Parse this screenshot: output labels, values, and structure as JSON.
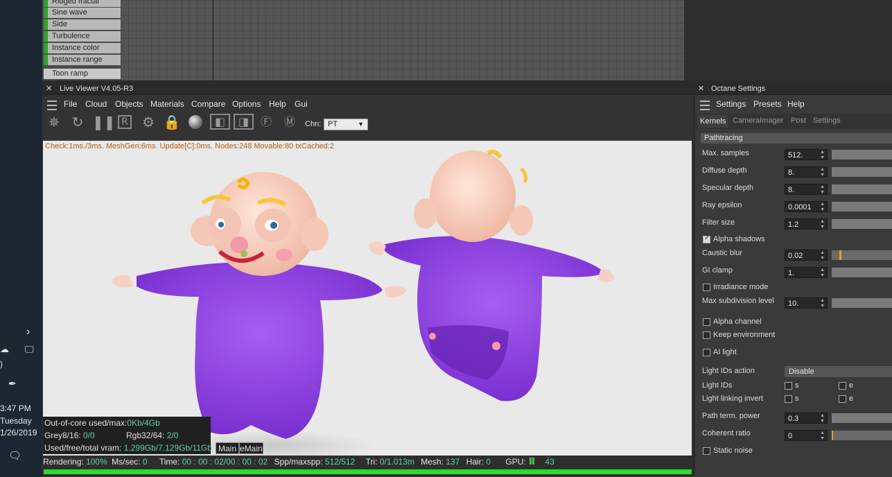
{
  "taskbar": {
    "time": "3:47 PM",
    "day": "Tuesday",
    "date": "1/26/2019"
  },
  "shader_list": {
    "items": [
      "Ridged fractal",
      "Sine wave",
      "Side",
      "Turbulence",
      "Instance color",
      "Instance range"
    ],
    "footer": "Toon ramp"
  },
  "live_viewer": {
    "title": "Live Viewer V4.05-R3",
    "menu": [
      "File",
      "Cloud",
      "Objects",
      "Materials",
      "Compare",
      "Options",
      "Help",
      "Gui"
    ],
    "channel_label": "Chn:",
    "channel_value": "PT",
    "info": "Check:1ms./3ms. MeshGen:6ms. Update[C]:0ms. Nodes:248 Movable:80 txCached:2",
    "ooc_label": "Out-of-core used/max:",
    "ooc_value": "0Kb/4Gb",
    "grey_label": "Grey8/16:",
    "grey_value": "0/0",
    "rgb_label": "Rgb32/64:",
    "rgb_value": "2/0",
    "vram_label": "Used/free/total vram:",
    "vram_value": "1.299Gb/7.129Gb/11Gb",
    "tab1": "Main",
    "tab2": "eMain",
    "status": {
      "rendering_label": "Rendering:",
      "rendering_value": "100%",
      "mssec_label": "Ms/sec:",
      "mssec_value": "0",
      "time_label": "Time:",
      "time_value": "00 : 00 : 02/00 : 00 : 02",
      "spp_label": "Spp/maxspp:",
      "spp_value": "512/512",
      "tri_label": "Tri:",
      "tri_value": "0/1.013m",
      "mesh_label": "Mesh:",
      "mesh_value": "137",
      "hair_label": "Hair:",
      "hair_value": "0",
      "gpu_label": "GPU:",
      "gpu_value": "43"
    },
    "progress": 1.0
  },
  "octane_settings": {
    "title": "Octane Settings",
    "menu": [
      "Settings",
      "Presets",
      "Help"
    ],
    "tabs": [
      "Kernels",
      "CameraImager",
      "Post",
      "Settings"
    ],
    "kernel": "Pathtracing",
    "params": {
      "max_samples": {
        "label": "Max. samples",
        "value": "512."
      },
      "diffuse_depth": {
        "label": "Diffuse depth",
        "value": "8."
      },
      "specular_depth": {
        "label": "Specular depth",
        "value": "8."
      },
      "ray_epsilon": {
        "label": "Ray epsilon",
        "value": "0.0001"
      },
      "filter_size": {
        "label": "Filter size",
        "value": "1.2"
      },
      "caustic_blur": {
        "label": "Caustic blur",
        "value": "0.02"
      },
      "gi_clamp": {
        "label": "GI clamp",
        "value": "1."
      },
      "max_subdiv": {
        "label": "Max subdivision level",
        "value": "10."
      },
      "path_term": {
        "label": "Path term. power",
        "value": "0.3"
      },
      "coherent_ratio": {
        "label": "Coherent ratio",
        "value": "0"
      }
    },
    "checks": {
      "alpha_shadows": {
        "label": "Alpha shadows",
        "checked": true
      },
      "irradiance_mode": {
        "label": "Irradiance mode",
        "checked": false
      },
      "alpha_channel": {
        "label": "Alpha channel",
        "checked": false
      },
      "keep_environment": {
        "label": "Keep environment",
        "checked": false
      },
      "ai_light": {
        "label": "AI light",
        "checked": false
      },
      "static_noise": {
        "label": "Static noise",
        "checked": false
      }
    },
    "light_ids_action_label": "Light IDs action",
    "light_ids_action_value": "Disable",
    "light_ids_label": "Light IDs",
    "light_linking_label": "Light linking invert",
    "opt_s": "s",
    "opt_e": "e"
  }
}
